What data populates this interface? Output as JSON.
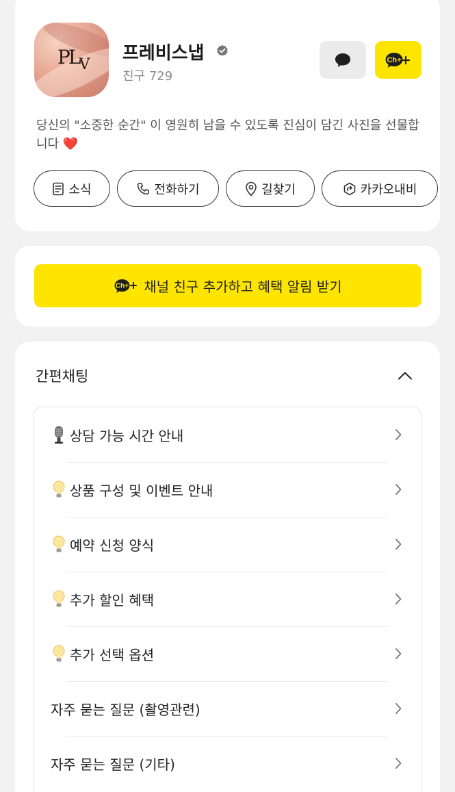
{
  "profile": {
    "avatar_logo": "PLV",
    "name": "프레비스냅",
    "friends_label": "친구 729",
    "description": "당신의 \"소중한 순간\" 이 영원히 남을 수  있도록 진심이 담긴 사진을 선물합니다 ❤️",
    "add_channel_badge": "Ch+"
  },
  "actions": [
    {
      "icon": "news-icon",
      "label": "소식"
    },
    {
      "icon": "phone-icon",
      "label": "전화하기"
    },
    {
      "icon": "location-pin-icon",
      "label": "길찾기"
    },
    {
      "icon": "kakao-navi-icon",
      "label": "카카오내비"
    }
  ],
  "benefit": {
    "badge": "Ch+",
    "label": "채널 친구 추가하고 혜택 알림 받기"
  },
  "quick_chat": {
    "title": "간편채팅",
    "items": [
      {
        "emoji": "microphone",
        "label": "상담 가능 시간 안내"
      },
      {
        "emoji": "lightbulb",
        "label": "상품 구성 및 이벤트 안내"
      },
      {
        "emoji": "lightbulb",
        "label": "예약 신청 양식"
      },
      {
        "emoji": "lightbulb",
        "label": "추가 할인 혜택"
      },
      {
        "emoji": "lightbulb",
        "label": "추가 선택 옵션"
      },
      {
        "emoji": "",
        "label": "자주 묻는 질문 (촬영관련)"
      },
      {
        "emoji": "",
        "label": "자주 묻는 질문 (기타)"
      }
    ]
  },
  "colors": {
    "kakao_yellow": "#fee500",
    "background": "#f2f2f2",
    "card": "#ffffff"
  }
}
